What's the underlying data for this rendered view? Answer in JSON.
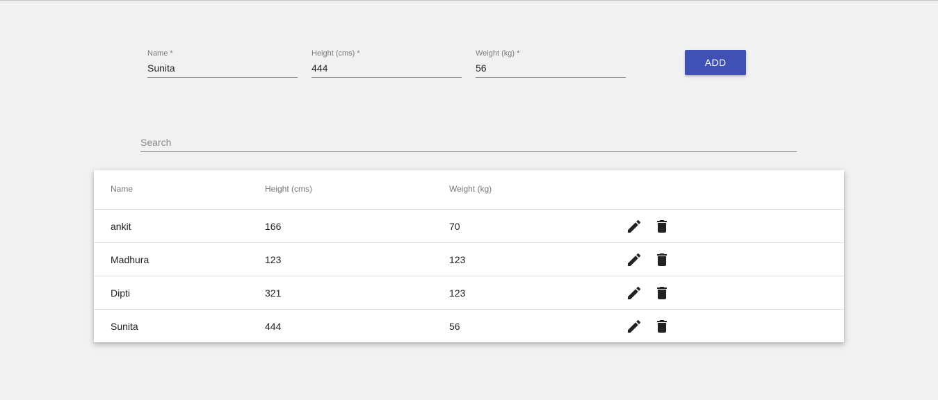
{
  "form": {
    "name": {
      "label": "Name *",
      "value": "Sunita"
    },
    "height": {
      "label": "Height (cms) *",
      "value": "444"
    },
    "weight": {
      "label": "Weight (kg) *",
      "value": "56"
    },
    "add_label": "ADD",
    "add_color": "#3f51b5"
  },
  "search": {
    "placeholder": "Search",
    "value": ""
  },
  "table": {
    "headers": {
      "name": "Name",
      "height": "Height (cms)",
      "weight": "Weight (kg)"
    },
    "rows": [
      {
        "name": "ankit",
        "height": "166",
        "weight": "70"
      },
      {
        "name": "Madhura",
        "height": "123",
        "weight": "123"
      },
      {
        "name": "Dipti",
        "height": "321",
        "weight": "123"
      },
      {
        "name": "Sunita",
        "height": "444",
        "weight": "56"
      }
    ],
    "row_icons": [
      "edit-icon",
      "delete-icon"
    ]
  }
}
